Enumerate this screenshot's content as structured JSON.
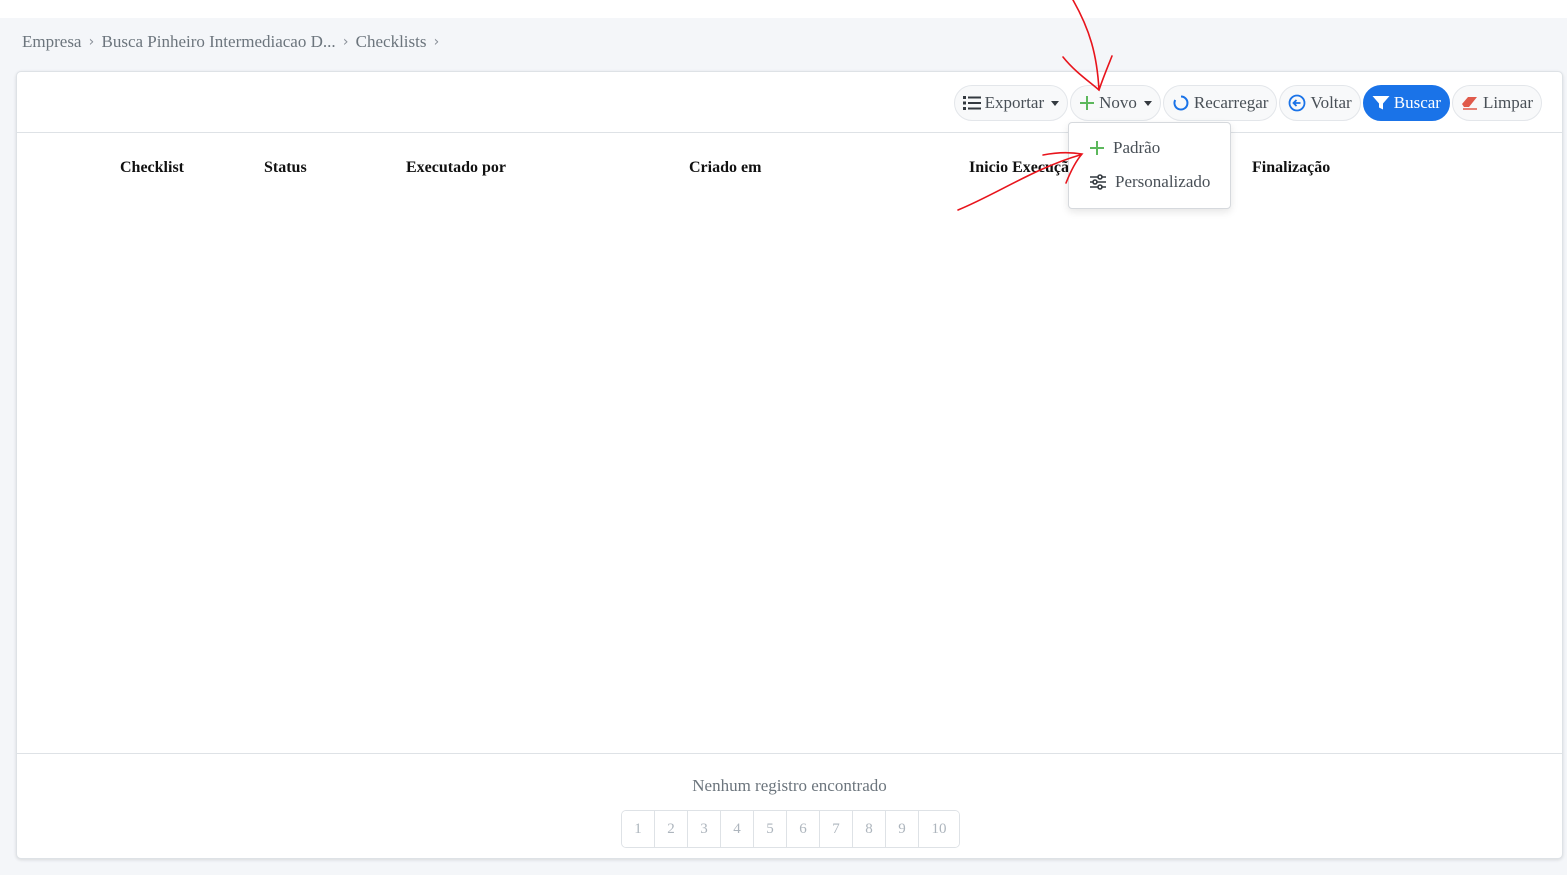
{
  "breadcrumb": {
    "items": [
      "Empresa",
      "Busca Pinheiro Intermediacao D...",
      "Checklists"
    ],
    "separator": ">"
  },
  "toolbar": {
    "export_label": "Exportar",
    "new_label": "Novo",
    "reload_label": "Recarregar",
    "back_label": "Voltar",
    "search_label": "Buscar",
    "clear_label": "Limpar"
  },
  "dropdown": {
    "items": [
      {
        "label": "Padrão",
        "icon": "plus-icon"
      },
      {
        "label": "Personalizado",
        "icon": "sliders-icon"
      }
    ]
  },
  "table": {
    "columns": [
      "Checklist",
      "Status",
      "Executado por",
      "Criado em",
      "Inicio Execuçã",
      "Finalização"
    ]
  },
  "footer": {
    "empty_message": "Nenhum registro encontrado",
    "pages": [
      "1",
      "2",
      "3",
      "4",
      "5",
      "6",
      "7",
      "8",
      "9",
      "10"
    ]
  },
  "colors": {
    "primary": "#1a73e8",
    "new_icon": "#5cb85c",
    "clear_icon": "#e05a4b",
    "annotation": "#e8141c"
  }
}
